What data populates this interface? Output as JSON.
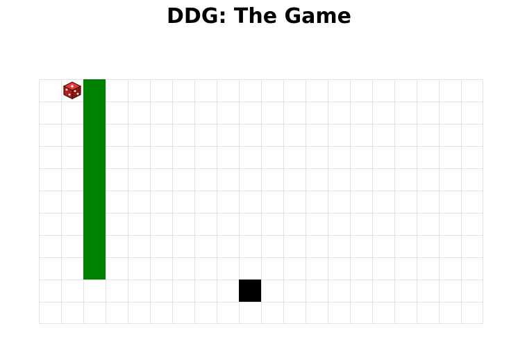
{
  "page": {
    "title": "DDG: The Game"
  },
  "game": {
    "grid": {
      "columns": 20,
      "rows": 11
    },
    "colors": {
      "grid_line": "#e0e0e0",
      "snake": "#008000",
      "food": "#000000",
      "dice": "#c62828"
    },
    "snake": {
      "cells": [
        [
          2,
          0
        ],
        [
          2,
          1
        ],
        [
          2,
          2
        ],
        [
          2,
          3
        ],
        [
          2,
          4
        ],
        [
          2,
          5
        ],
        [
          2,
          6
        ],
        [
          2,
          7
        ],
        [
          2,
          8
        ]
      ]
    },
    "food": {
      "cell": [
        9,
        9
      ]
    },
    "dice": {
      "icon": "dice-icon",
      "cell": [
        1,
        0
      ]
    }
  }
}
